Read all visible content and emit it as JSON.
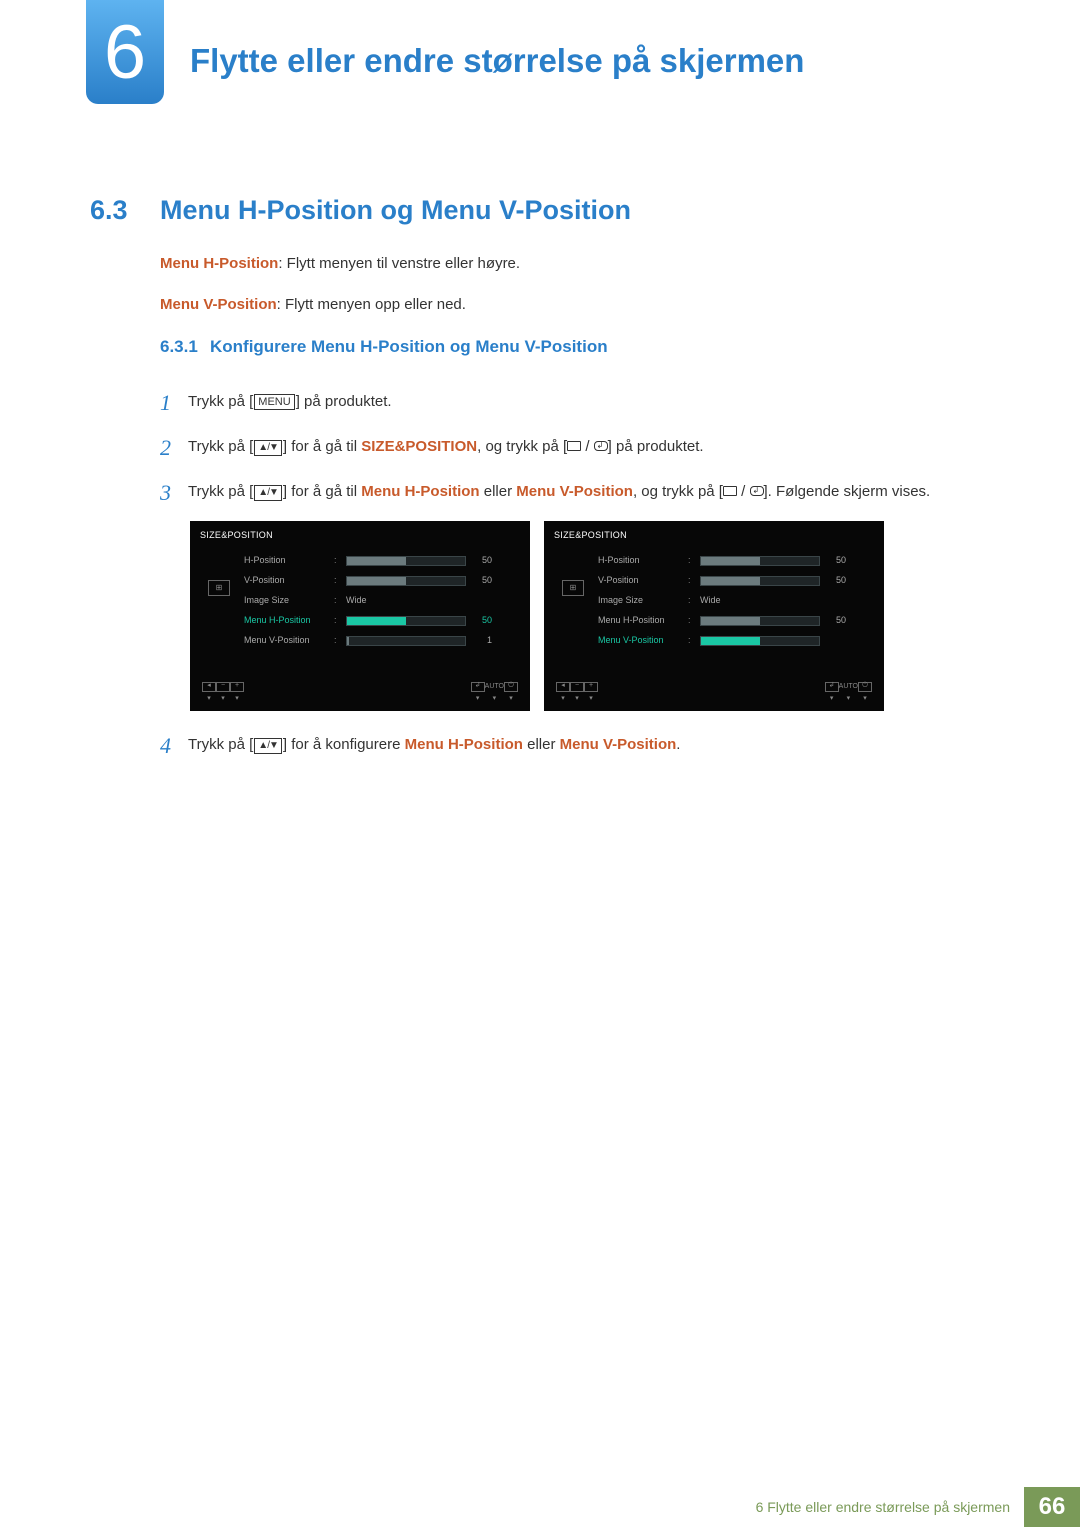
{
  "chapter": {
    "num": "6",
    "title": "Flytte eller endre størrelse på skjermen"
  },
  "section": {
    "num": "6.3",
    "title": "Menu H-Position og Menu V-Position"
  },
  "desc1_label": "Menu H-Position",
  "desc1_text": ": Flytt menyen til venstre eller høyre.",
  "desc2_label": "Menu V-Position",
  "desc2_text": ": Flytt menyen opp eller ned.",
  "subsection": {
    "num": "6.3.1",
    "title": "Konfigurere Menu H-Position og Menu V-Position"
  },
  "steps": {
    "s1": {
      "n": "1",
      "pre": "Trykk på [",
      "menu": "MENU",
      "post": "] på produktet."
    },
    "s2": {
      "n": "2",
      "pre": "Trykk på [",
      "mid": "] for å gå til ",
      "target": "SIZE&POSITION",
      "mid2": ", og trykk på [",
      "post": "] på produktet."
    },
    "s3": {
      "n": "3",
      "pre": "Trykk på [",
      "mid": "] for å gå til ",
      "t1": "Menu H-Position",
      "or": " eller ",
      "t2": "Menu V-Position",
      "mid2": ", og trykk på [",
      "post": "]. Følgende skjerm vises."
    },
    "s4": {
      "n": "4",
      "pre": "Trykk på [",
      "mid": "] for å konfigurere ",
      "t1": "Menu H-Position",
      "or": " eller ",
      "t2": "Menu V-Position",
      "post": "."
    }
  },
  "osd": {
    "title": "SIZE&POSITION",
    "rows": {
      "hpos": {
        "label": "H-Position",
        "val": "50",
        "fill": 50
      },
      "vpos": {
        "label": "V-Position",
        "val": "50",
        "fill": 50
      },
      "isize": {
        "label": "Image Size",
        "text": "Wide"
      },
      "mhpos": {
        "label": "Menu H-Position",
        "val": "50",
        "fill": 50
      },
      "mvpos_l": {
        "label": "Menu V-Position",
        "val": "1",
        "fill": 2
      },
      "mvpos_r": {
        "label": "Menu V-Position",
        "val": "",
        "fill": 50
      }
    },
    "footer": {
      "auto": "AUTO"
    }
  },
  "footer": {
    "text": "6 Flytte eller endre størrelse på skjermen",
    "page": "66"
  }
}
